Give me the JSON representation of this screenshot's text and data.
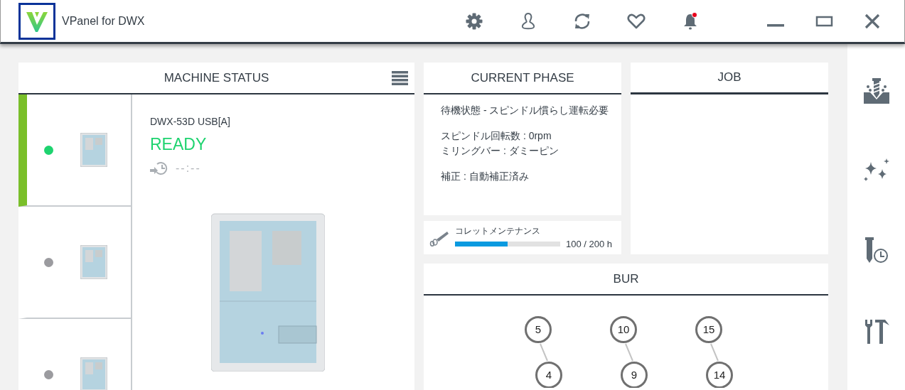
{
  "window": {
    "title": "VPanel for DWX",
    "has_notification": true
  },
  "machine_status": {
    "title": "MACHINE STATUS",
    "machines": [
      {
        "selected": true,
        "color": "#1ed36f"
      },
      {
        "selected": false,
        "color": "#9b9b9f"
      },
      {
        "selected": false,
        "color": "#9b9b9f"
      }
    ],
    "selected_machine": {
      "name": "DWX-53D USB[A]",
      "status": "READY",
      "time": "--:--"
    }
  },
  "current_phase": {
    "title": "CURRENT PHASE",
    "paragraphs": [
      [
        "待機状態 - スピンドル慣らし運転必要"
      ],
      [
        "スピンドル回転数 : 0rpm",
        "ミリングバー :  ダミーピン"
      ],
      [
        "補正 : 自動補正済み"
      ]
    ]
  },
  "collet_maintenance": {
    "label": "コレットメンテナンス",
    "level": 0.5,
    "reading": "100 / 200 h"
  },
  "job": {
    "title": "JOB"
  },
  "bur": {
    "title": "BUR",
    "pairs": [
      {
        "upper": "5",
        "lower": "4"
      },
      {
        "upper": "10",
        "lower": "9"
      },
      {
        "upper": "15",
        "lower": "14"
      }
    ]
  }
}
